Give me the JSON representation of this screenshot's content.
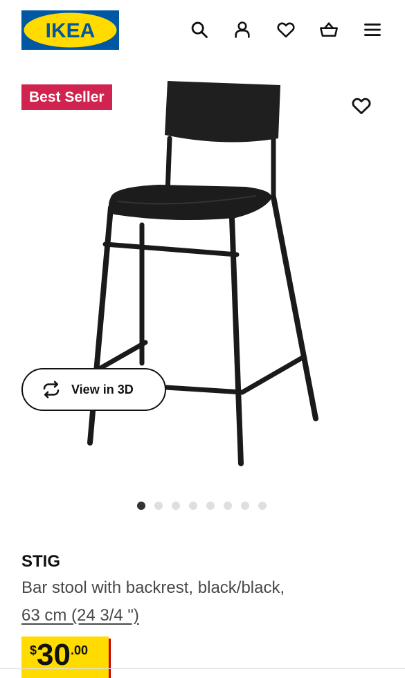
{
  "header": {
    "logo_text": "IKEA",
    "icons": [
      "search-icon",
      "account-icon",
      "heart-icon",
      "cart-icon",
      "menu-icon"
    ]
  },
  "gallery": {
    "badge": "Best Seller",
    "view3d_label": "View in 3D",
    "dots_total": 8,
    "active_dot": 1
  },
  "product": {
    "name": "STIG",
    "description": "Bar stool with backrest, black/black,",
    "size_link": "63 cm (24 3/4 \")",
    "price": {
      "currency": "$",
      "integer": "30",
      "decimals": ".00"
    }
  },
  "colors": {
    "ikea_blue": "#0058a3",
    "ikea_yellow": "#ffdb00",
    "badge_red": "#d1234f",
    "price_red": "#cc0008"
  }
}
